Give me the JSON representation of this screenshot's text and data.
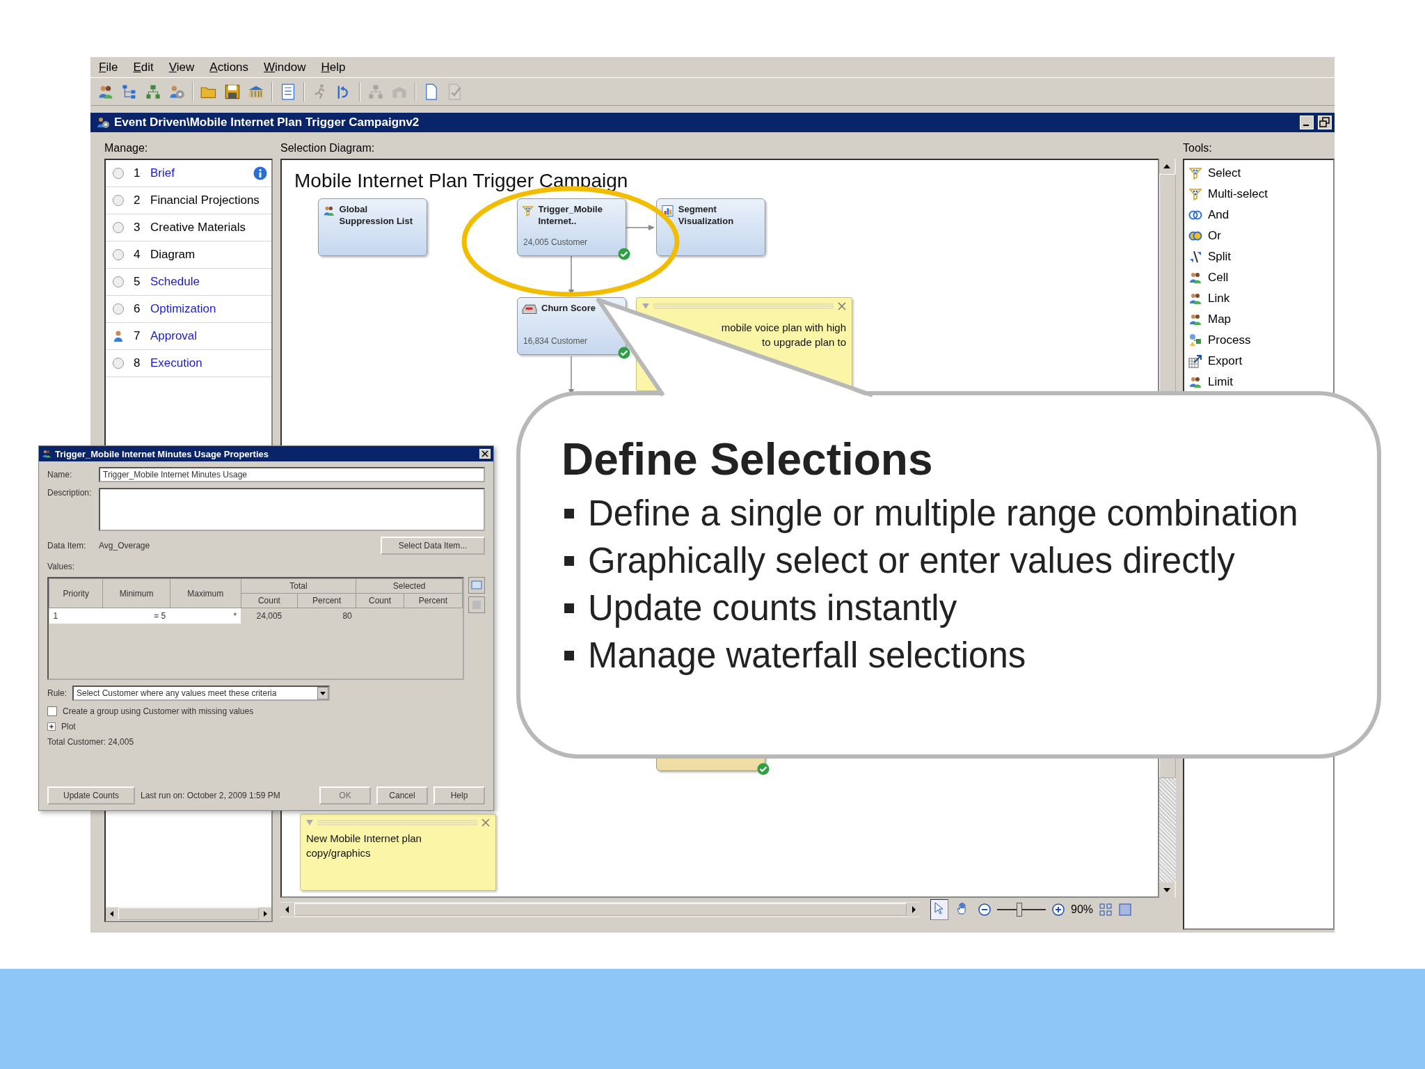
{
  "menu": [
    {
      "label": "File"
    },
    {
      "label": "Edit"
    },
    {
      "label": "View"
    },
    {
      "label": "Actions"
    },
    {
      "label": "Window"
    },
    {
      "label": "Help"
    }
  ],
  "toolbar": [
    {
      "kind": "people",
      "disabled": false
    },
    {
      "kind": "tree",
      "disabled": false
    },
    {
      "kind": "hierarchy",
      "disabled": false
    },
    {
      "kind": "people-gear",
      "disabled": false
    },
    {
      "kind": "separator"
    },
    {
      "kind": "folder",
      "disabled": false
    },
    {
      "kind": "disk",
      "disabled": false
    },
    {
      "kind": "building",
      "disabled": false
    },
    {
      "kind": "separator"
    },
    {
      "kind": "list",
      "disabled": false
    },
    {
      "kind": "separator"
    },
    {
      "kind": "runner",
      "disabled": true
    },
    {
      "kind": "arrow",
      "disabled": false
    },
    {
      "kind": "separator"
    },
    {
      "kind": "hierarchy",
      "disabled": true
    },
    {
      "kind": "box",
      "disabled": true
    },
    {
      "kind": "separator"
    },
    {
      "kind": "page",
      "disabled": false
    },
    {
      "kind": "page-check",
      "disabled": true
    }
  ],
  "window": {
    "title": "Event Driven\\Mobile Internet Plan Trigger Campaignv2"
  },
  "manage": {
    "label": "Manage:",
    "items": [
      {
        "number": "1",
        "label": "Brief",
        "link": true,
        "kind": "circle",
        "info": true
      },
      {
        "number": "2",
        "label": "Financial Projections",
        "link": false,
        "kind": "circle",
        "info": false
      },
      {
        "number": "3",
        "label": "Creative Materials",
        "link": false,
        "kind": "circle",
        "info": false
      },
      {
        "number": "4",
        "label": "Diagram",
        "link": false,
        "kind": "circle",
        "info": false
      },
      {
        "number": "5",
        "label": "Schedule",
        "link": true,
        "kind": "circle",
        "info": false
      },
      {
        "number": "6",
        "label": "Optimization",
        "link": true,
        "kind": "circle",
        "info": false
      },
      {
        "number": "7",
        "label": "Approval",
        "link": true,
        "kind": "person",
        "info": false
      },
      {
        "number": "8",
        "label": "Execution",
        "link": true,
        "kind": "circle",
        "info": false
      }
    ]
  },
  "diagram": {
    "label": "Selection Diagram:",
    "title": "Mobile Internet Plan Trigger Campaign",
    "nodes": [
      {
        "kind": "people",
        "title": "Global Suppression List",
        "checked": false
      },
      {
        "kind": "funnel",
        "title": "Trigger_Mobile Internet..",
        "count": "24,005 Customer",
        "checked": true
      },
      {
        "kind": "chart",
        "title": "Segment Visualization",
        "checked": false
      },
      {
        "kind": "score",
        "title": "Churn Score",
        "count": "16,834 Customer",
        "checked": true
      },
      {
        "kind": "hidden",
        "checked": true
      }
    ],
    "notes": [
      {
        "lines": [
          "mobile voice plan with high",
          "to upgrade plan to"
        ]
      },
      {
        "lines": [
          "New Mobile Internet plan",
          "copy/graphics"
        ]
      }
    ],
    "zoom": {
      "tools": [
        {
          "kind": "pointer",
          "selected": true
        },
        {
          "kind": "hand",
          "selected": false
        }
      ],
      "level": 0.45,
      "reading": "90%"
    }
  },
  "tools": {
    "label": "Tools:",
    "items": [
      {
        "kind": "funnel",
        "label": "Select"
      },
      {
        "kind": "funnel",
        "label": "Multi-select"
      },
      {
        "kind": "rings",
        "label": "And"
      },
      {
        "kind": "rings-filled",
        "label": "Or"
      },
      {
        "kind": "split",
        "label": "Split"
      },
      {
        "kind": "people",
        "label": "Cell"
      },
      {
        "kind": "people",
        "label": "Link"
      },
      {
        "kind": "people",
        "label": "Map"
      },
      {
        "kind": "process",
        "label": "Process"
      },
      {
        "kind": "table-arrow",
        "label": "Export"
      },
      {
        "kind": "people",
        "label": "Limit"
      }
    ]
  },
  "dialog": {
    "title": "Trigger_Mobile Internet Minutes Usage Properties",
    "name_label": "Name:",
    "name_value": "Trigger_Mobile Internet Minutes Usage",
    "description_label": "Description:",
    "data_item_label": "Data Item:",
    "data_item_value": "Avg_Overage",
    "select_button": "Select Data Item...",
    "values_label": "Values:",
    "columns": [
      "Priority",
      "Minimum",
      "Maximum"
    ],
    "groups": [
      {
        "label": "Total",
        "columns": [
          "Count",
          "Percent"
        ]
      },
      {
        "label": "Selected",
        "columns": [
          "Count",
          "Percent"
        ]
      }
    ],
    "rows": [
      [
        "1",
        "= 5",
        "*",
        "24,005",
        "80"
      ]
    ],
    "rule_label": "Rule:",
    "rule_value": "Select Customer where any values meet these criteria",
    "missing_group": {
      "label": "Create a group using Customer with missing values",
      "checked": false
    },
    "plot": {
      "label": "Plot",
      "expanded": false
    },
    "total": "Total Customer: 24,005",
    "update_button": "Update Counts",
    "last_run": "Last run on: October 2, 2009 1:59 PM",
    "actions": [
      {
        "label": "OK",
        "disabled": true
      },
      {
        "label": "Cancel",
        "disabled": false
      },
      {
        "label": "Help",
        "disabled": false
      }
    ]
  },
  "callout": {
    "title": "Define Selections",
    "bullets": [
      "Define a single or multiple range combination",
      "Graphically select or enter values directly",
      "Update counts instantly",
      "Manage waterfall selections"
    ]
  }
}
